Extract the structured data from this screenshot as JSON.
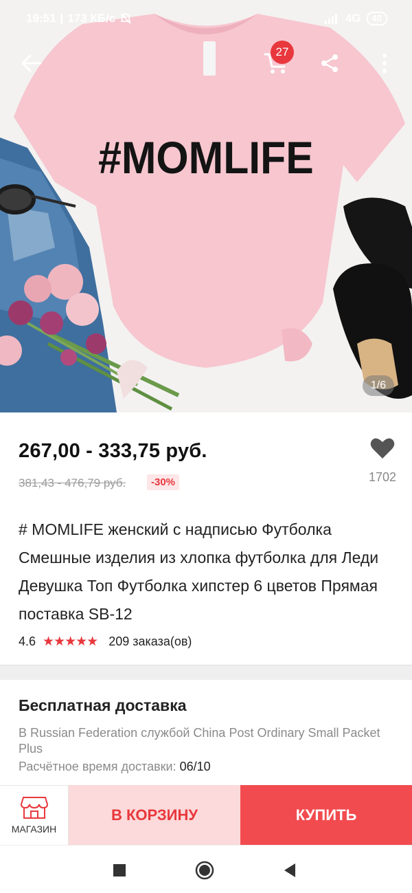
{
  "status_bar": {
    "time": "19:51",
    "speed": "173 КБ/с",
    "network": "4G",
    "battery": "40"
  },
  "header": {
    "cart_count": "27",
    "icons": [
      "back-arrow-icon",
      "cart-icon",
      "share-icon",
      "more-vert-icon"
    ]
  },
  "gallery": {
    "shirt_text": "#MOMLIFE",
    "counter": "1/6"
  },
  "product": {
    "price": "267,00 - 333,75 руб.",
    "old_price": "381,43 - 476,79 руб.",
    "discount": "-30%",
    "favorites": "1702",
    "title": "# MOMLIFE женский с надписью Футболка Смешные изделия из хлопка футболка для Леди Девушка Топ Футболка хипстер 6 цветов Прямая поставка SB-12",
    "rating": "4.6",
    "rating_stars": 4.6,
    "orders": "209 заказа(ов)"
  },
  "shipping": {
    "title": "Бесплатная доставка",
    "description": "В Russian Federation службой China Post Ordinary Small Packet Plus",
    "eta_label": "Расчётное время доставки:",
    "eta_value": "06/10"
  },
  "actions": {
    "store_label": "МАГАЗИН",
    "cart_label": "В КОРЗИНУ",
    "buy_label": "КУПИТЬ"
  },
  "colors": {
    "accent": "#e8383d",
    "buy": "#f24b4f",
    "cart_bg": "#fcd9da",
    "shirt": "#f7c6cf"
  }
}
